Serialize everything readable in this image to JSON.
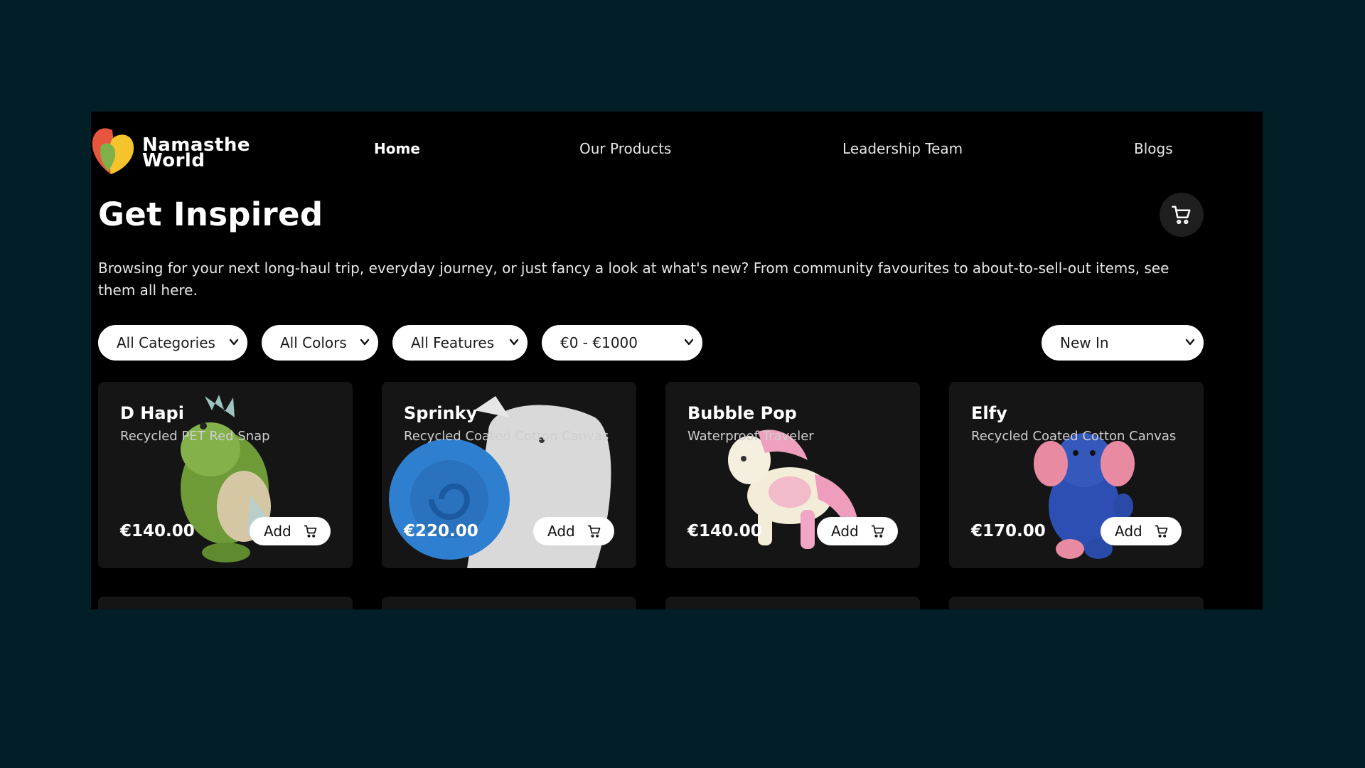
{
  "brand": {
    "name_line1": "Namasthe",
    "name_line2": "World"
  },
  "nav": [
    {
      "label": "Home",
      "active": true
    },
    {
      "label": "Our Products",
      "active": false
    },
    {
      "label": "Leadership Team",
      "active": false
    },
    {
      "label": "Blogs",
      "active": false
    }
  ],
  "page": {
    "title": "Get Inspired",
    "description": "Browsing for your next long-haul trip, everyday journey, or just fancy a look at what's new? From community favourites to about-to-sell-out items, see them all here.",
    "cart_icon": "cart-icon"
  },
  "filters": {
    "category": "All Categories",
    "color": "All Colors",
    "feature": "All Features",
    "price": "€0 - €1000",
    "sort": "New In"
  },
  "products": [
    {
      "name": "D Hapi",
      "material": "Recycled PET Red Snap",
      "price": "€140.00",
      "add_label": "Add",
      "toy_color": "#7fa63c"
    },
    {
      "name": "Sprinky",
      "material": "Recycled Coated Cotton Canvas",
      "price": "€220.00",
      "add_label": "Add",
      "toy_color": "#2f7fd0"
    },
    {
      "name": "Bubble Pop",
      "material": "Waterproof Traveler",
      "price": "€140.00",
      "add_label": "Add",
      "toy_color": "#f2a7c6"
    },
    {
      "name": "Elfy",
      "material": "Recycled Coated Cotton Canvas",
      "price": "€170.00",
      "add_label": "Add",
      "toy_color": "#2d4fb3"
    }
  ],
  "colors": {
    "page_bg": "#021e27",
    "panel_bg": "#000000",
    "card_bg": "#151515"
  }
}
